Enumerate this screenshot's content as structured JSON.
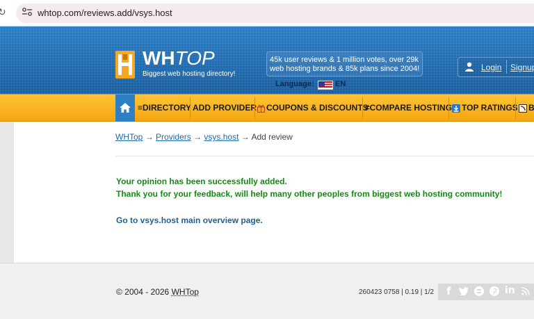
{
  "browser": {
    "url": "whtop.com/reviews.add/vsys.host"
  },
  "header": {
    "logo_title_bold": "WH",
    "logo_title_light": "TOP",
    "logo_subtitle": "Biggest web hosting directory!",
    "stats_line1": "45k user reviews & 1 million votes, over 29k",
    "stats_line2": "web hosting brands & 85k plans since 2004!",
    "language_label": "Language:",
    "language_code": "EN",
    "login_label": "Login",
    "signup_label": "Signup"
  },
  "nav": {
    "items": [
      {
        "label": "≡DIRECTORY"
      },
      {
        "label": "ADD PROVIDER"
      },
      {
        "label": "COUPONS & DISCOUNTS"
      },
      {
        "label": "≠COMPARE HOSTING"
      },
      {
        "label": "TOP RATINGS"
      },
      {
        "label": "B"
      }
    ]
  },
  "breadcrumb": {
    "items": [
      "WHTop",
      "Providers",
      "vsys.host"
    ],
    "separator": "→",
    "current": "Add review"
  },
  "main": {
    "success_message": "Your opinion has been successfully added.",
    "thanks_message": "Thank you for your feedback, will help many other peoples from biggest web hosting community!",
    "goto_link": "Go to vsys.host main overview page."
  },
  "footer": {
    "copyright_prefix": "© 2004 - 2026 ",
    "copyright_brand": "WHTop",
    "build_info": "260423 0758 | 0.19 | 1/2",
    "social": [
      "f",
      "y",
      "B",
      "p",
      "in",
      "rss"
    ]
  },
  "colors": {
    "header_blue": "#1f6fb8",
    "nav_orange": "#f4a60f",
    "success_green": "#138a13",
    "link_blue": "#1a6aa9"
  }
}
